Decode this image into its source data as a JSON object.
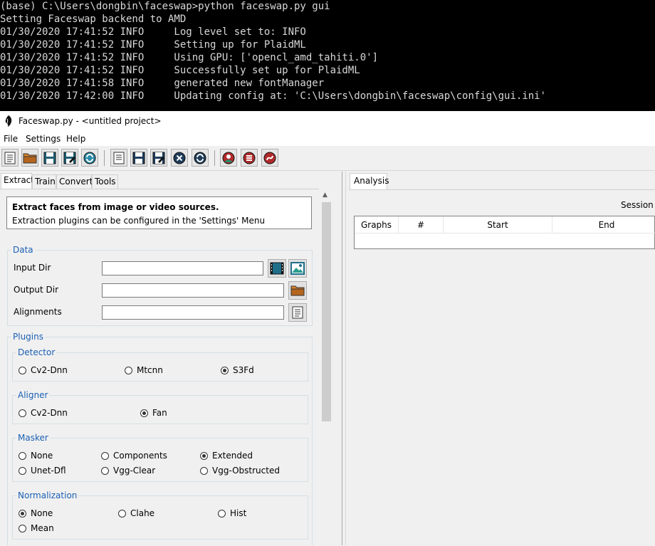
{
  "console": {
    "lines": [
      "(base) C:\\Users\\dongbin\\faceswap>python faceswap.py gui",
      "Setting Faceswap backend to AMD",
      "01/30/2020 17:41:52 INFO     Log level set to: INFO",
      "01/30/2020 17:41:52 INFO     Setting up for PlaidML",
      "01/30/2020 17:41:52 INFO     Using GPU: ['opencl_amd_tahiti.0']",
      "01/30/2020 17:41:52 INFO     Successfully set up for PlaidML",
      "01/30/2020 17:41:58 INFO     generated new fontManager",
      "01/30/2020 17:42:00 INFO     Updating config at: 'C:\\Users\\dongbin\\faceswap\\config\\gui.ini'"
    ]
  },
  "window": {
    "title": "Faceswap.py - <untitled project>"
  },
  "menu": {
    "file": "File",
    "settings": "Settings",
    "help": "Help"
  },
  "toolbar": {
    "icons": [
      "new-project-icon",
      "open-project-icon",
      "save-project-icon",
      "save-project-as-icon",
      "reload-project-icon",
      "new-task-icon",
      "save-task-icon",
      "save-task-as-icon",
      "clear-task-icon",
      "reload-task-icon",
      "generate-icon",
      "task-list-icon",
      "reset-icon"
    ]
  },
  "left_tabs": {
    "extract": "Extract",
    "train": "Train",
    "convert": "Convert",
    "tools": "Tools"
  },
  "description": {
    "line1": "Extract faces from image or video sources.",
    "line2": "Extraction plugins can be configured in the 'Settings' Menu"
  },
  "data_group": {
    "label": "Data",
    "input_dir": {
      "label": "Input Dir",
      "value": ""
    },
    "output_dir": {
      "label": "Output Dir",
      "value": ""
    },
    "alignments": {
      "label": "Alignments",
      "value": ""
    }
  },
  "plugins": {
    "label": "Plugins",
    "detector": {
      "label": "Detector",
      "options": [
        "Cv2-Dnn",
        "Mtcnn",
        "S3Fd"
      ],
      "selected": "S3Fd"
    },
    "aligner": {
      "label": "Aligner",
      "options": [
        "Cv2-Dnn",
        "Fan"
      ],
      "selected": "Fan"
    },
    "masker": {
      "label": "Masker",
      "options": [
        "None",
        "Components",
        "Extended",
        "Unet-Dfl",
        "Vgg-Clear",
        "Vgg-Obstructed"
      ],
      "selected": "Extended"
    },
    "normalization": {
      "label": "Normalization",
      "options": [
        "None",
        "Clahe",
        "Hist",
        "Mean"
      ],
      "selected": "None"
    }
  },
  "right": {
    "tab": "Analysis",
    "session_label": "Session S",
    "columns": [
      "Graphs",
      "#",
      "Start",
      "End"
    ]
  },
  "colors": {
    "group_label": "#1a5fb4",
    "console_bg": "#000000"
  }
}
